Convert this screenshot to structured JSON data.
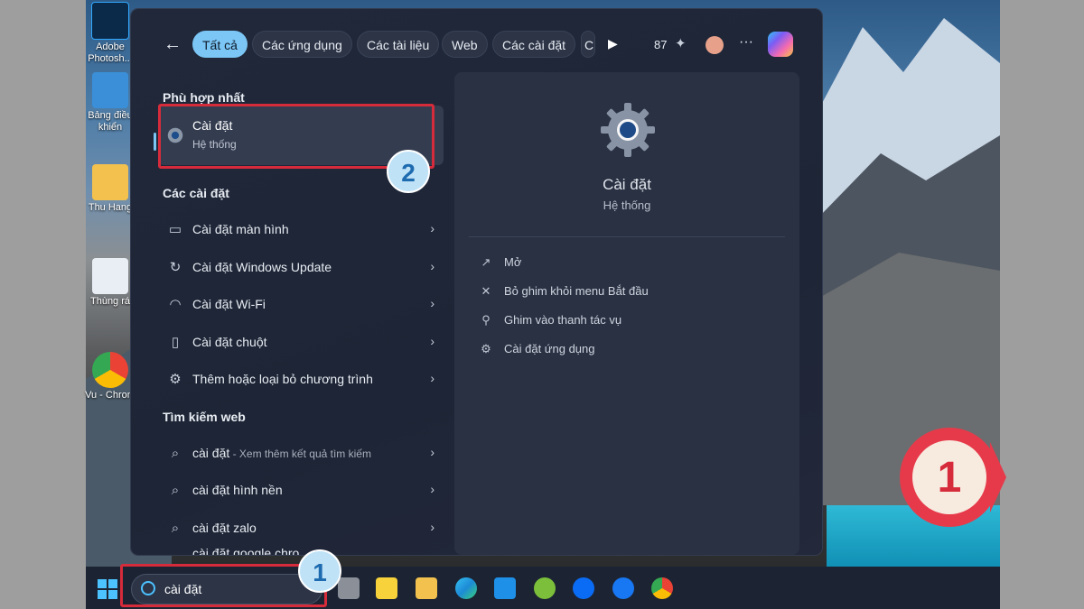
{
  "desktop_icons": [
    {
      "label": "Adobe Photosh..."
    },
    {
      "label": "Bảng điều khiển"
    },
    {
      "label": "Thu Hang"
    },
    {
      "label": "Thùng rá"
    },
    {
      "label": "Vu - Chrom"
    }
  ],
  "search_panel": {
    "tabs": [
      "Tất cả",
      "Các ứng dụng",
      "Các tài liệu",
      "Web",
      "Các cài đặt",
      "C"
    ],
    "points": "87",
    "best_match_heading": "Phù hợp nhất",
    "best_match": {
      "title": "Cài đặt",
      "subtitle": "Hệ thống"
    },
    "settings_heading": "Các cài đặt",
    "settings_items": [
      {
        "label": "Cài đặt màn hình",
        "icon": "monitor-icon"
      },
      {
        "label": "Cài đặt Windows Update",
        "icon": "refresh-icon"
      },
      {
        "label": "Cài đặt Wi-Fi",
        "icon": "wifi-icon"
      },
      {
        "label": "Cài đặt chuột",
        "icon": "mouse-icon"
      },
      {
        "label": "Thêm hoặc loại bỏ chương trình",
        "icon": "gear-icon"
      }
    ],
    "web_heading": "Tìm kiếm web",
    "web_items": [
      {
        "label": "cài đặt",
        "suffix": " - Xem thêm kết quả tìm kiếm"
      },
      {
        "label": "cài đặt hình nền",
        "suffix": ""
      },
      {
        "label": "cài đặt zalo",
        "suffix": ""
      },
      {
        "label": "cài đặt google chro",
        "suffix": ""
      }
    ],
    "detail": {
      "title": "Cài đặt",
      "subtitle": "Hệ thống",
      "actions": [
        {
          "label": "Mở",
          "icon": "open-external-icon"
        },
        {
          "label": "Bỏ ghim khỏi menu Bắt đầu",
          "icon": "unpin-icon"
        },
        {
          "label": "Ghim vào thanh tác vụ",
          "icon": "pin-icon"
        },
        {
          "label": "Cài đặt ứng dụng",
          "icon": "gear-icon"
        }
      ]
    }
  },
  "taskbar": {
    "search_value": "cài đặt"
  },
  "annotations": {
    "step1": "1",
    "step2": "2"
  },
  "colors": {
    "accent": "#7cc6f5",
    "highlight_red": "#d62b3a"
  }
}
